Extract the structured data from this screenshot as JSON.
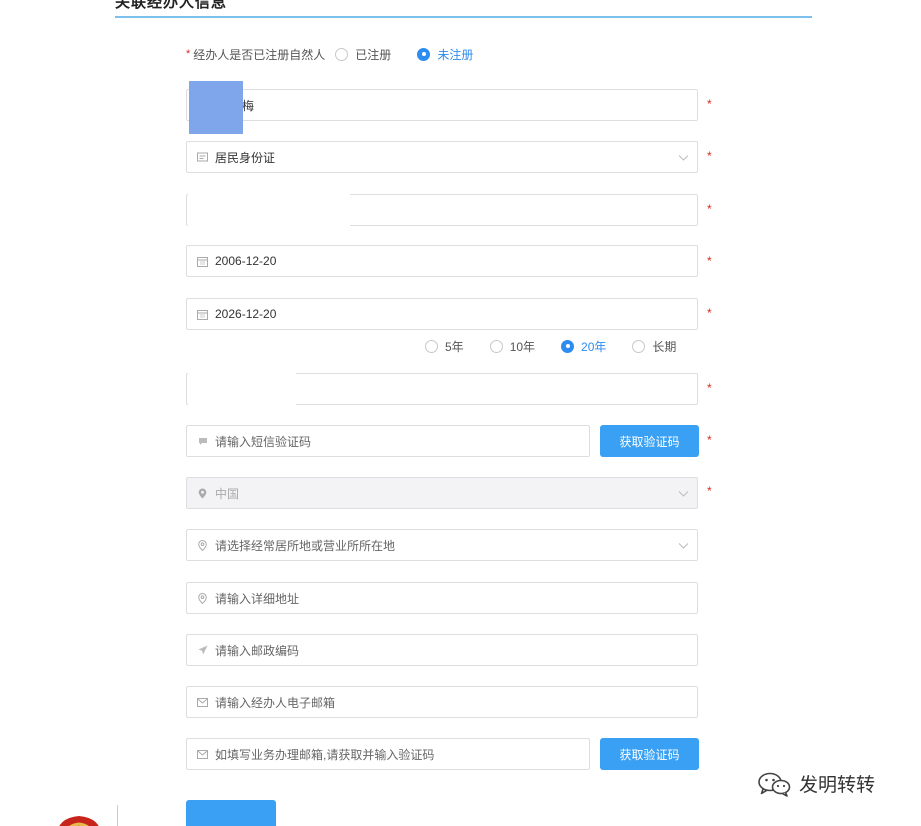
{
  "section": {
    "title": "关联经办人信息"
  },
  "registration": {
    "label": "经办人是否已注册自然人",
    "options": [
      {
        "label": "已注册",
        "selected": false
      },
      {
        "label": "未注册",
        "selected": true
      }
    ]
  },
  "fields": {
    "name_value": "梅",
    "id_type_value": "居民身份证",
    "id_number_value": "",
    "valid_from": "2006-12-20",
    "valid_to": "2026-12-20",
    "phone_value": "",
    "sms_code_placeholder": "请输入短信验证码",
    "country_value": "中国",
    "residence_placeholder": "请选择经常居所地或营业所所在地",
    "address_placeholder": "请输入详细地址",
    "postal_placeholder": "请输入邮政编码",
    "email_placeholder": "请输入经办人电子邮箱",
    "business_email_placeholder": "如填写业务办理邮箱,请获取并输入验证码"
  },
  "validity_terms": [
    {
      "label": "5年",
      "selected": false
    },
    {
      "label": "10年",
      "selected": false
    },
    {
      "label": "20年",
      "selected": true
    },
    {
      "label": "长期",
      "selected": false
    }
  ],
  "buttons": {
    "get_code_sms": "获取验证码",
    "get_code_email": "获取验证码"
  },
  "required_mark": "*",
  "watermark": {
    "text": "发明转转"
  },
  "colors": {
    "accent": "#2d8cf0",
    "button": "#39a0f4",
    "required": "#e0281c",
    "title_line": "#7cc1ee"
  }
}
